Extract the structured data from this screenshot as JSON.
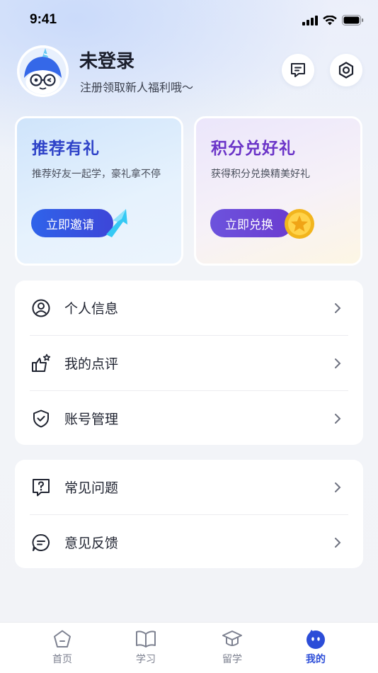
{
  "status_bar": {
    "time": "9:41"
  },
  "profile": {
    "name": "未登录",
    "subtitle": "注册领取新人福利哦～"
  },
  "header_actions": {
    "message_icon": "message-icon",
    "settings_icon": "settings-icon"
  },
  "promo": {
    "left": {
      "title": "推荐有礼",
      "desc": "推荐好友一起学，豪礼拿不停",
      "button": "立即邀请"
    },
    "right": {
      "title": "积分兑好礼",
      "desc": "获得积分兑换精美好礼",
      "button": "立即兑换"
    }
  },
  "menu_group_1": [
    {
      "label": "个人信息",
      "icon": "user-circle-icon"
    },
    {
      "label": "我的点评",
      "icon": "thumbs-up-icon"
    },
    {
      "label": "账号管理",
      "icon": "shield-check-icon"
    }
  ],
  "menu_group_2": [
    {
      "label": "常见问题",
      "icon": "question-icon"
    },
    {
      "label": "意见反馈",
      "icon": "feedback-icon"
    }
  ],
  "tabs": [
    {
      "label": "首页",
      "icon": "home-icon",
      "active": false
    },
    {
      "label": "学习",
      "icon": "book-icon",
      "active": false
    },
    {
      "label": "留学",
      "icon": "graduation-cap-icon",
      "active": false
    },
    {
      "label": "我的",
      "icon": "mine-face-icon",
      "active": true
    }
  ],
  "colors": {
    "accent": "#2c4dd8",
    "left_title": "#2e42c8",
    "right_title": "#6b34c8"
  }
}
